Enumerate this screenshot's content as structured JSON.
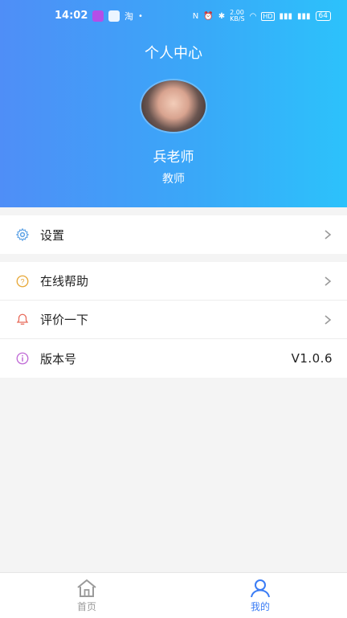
{
  "status_bar": {
    "time": "14:02",
    "network_speed": "2.00\nKB/S",
    "hd_label": "HD",
    "battery": "64"
  },
  "header": {
    "title": "个人中心",
    "user_name": "兵老师",
    "user_role": "教师"
  },
  "menu": {
    "settings": {
      "label": "设置",
      "icon": "gear-icon"
    },
    "help": {
      "label": "在线帮助",
      "icon": "question-icon"
    },
    "rate": {
      "label": "评价一下",
      "icon": "rate-icon"
    },
    "version": {
      "label": "版本号",
      "value": "V1.0.6",
      "icon": "info-icon"
    }
  },
  "bottom_nav": {
    "home": {
      "label": "首页",
      "icon": "home-icon"
    },
    "mine": {
      "label": "我的",
      "icon": "user-icon"
    }
  },
  "colors": {
    "accent": "#3a7cf5",
    "header_gradient_start": "#4f8ef7",
    "header_gradient_end": "#2cc2fb"
  }
}
